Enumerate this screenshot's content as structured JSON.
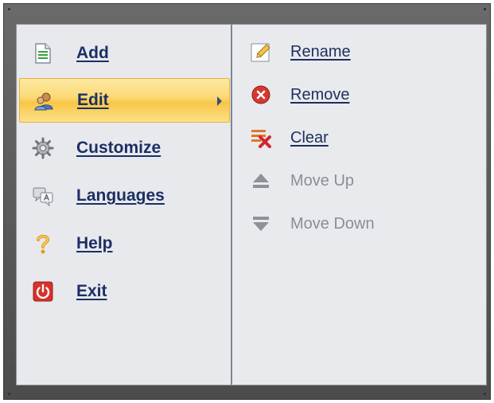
{
  "menu": {
    "left_items": [
      {
        "label": "Add",
        "icon": "add-document-icon"
      },
      {
        "label": "Edit",
        "icon": "edit-users-icon",
        "active": true
      },
      {
        "label": "Customize",
        "icon": "gear-icon"
      },
      {
        "label": "Languages",
        "icon": "languages-icon"
      },
      {
        "label": "Help",
        "icon": "help-icon"
      },
      {
        "label": "Exit",
        "icon": "exit-power-icon"
      }
    ],
    "right_items": [
      {
        "label": "Rename",
        "icon": "pencil-icon",
        "enabled": true
      },
      {
        "label": "Remove",
        "icon": "remove-icon",
        "enabled": true
      },
      {
        "label": "Clear",
        "icon": "clear-icon",
        "enabled": true
      },
      {
        "label": "Move Up",
        "icon": "move-up-icon",
        "enabled": false
      },
      {
        "label": "Move Down",
        "icon": "move-down-icon",
        "enabled": false
      }
    ]
  },
  "colors": {
    "highlight": "#fbd872",
    "label_text": "#1c2f63",
    "disabled_text": "#8a8d93",
    "frame": "#5a5a5a"
  }
}
